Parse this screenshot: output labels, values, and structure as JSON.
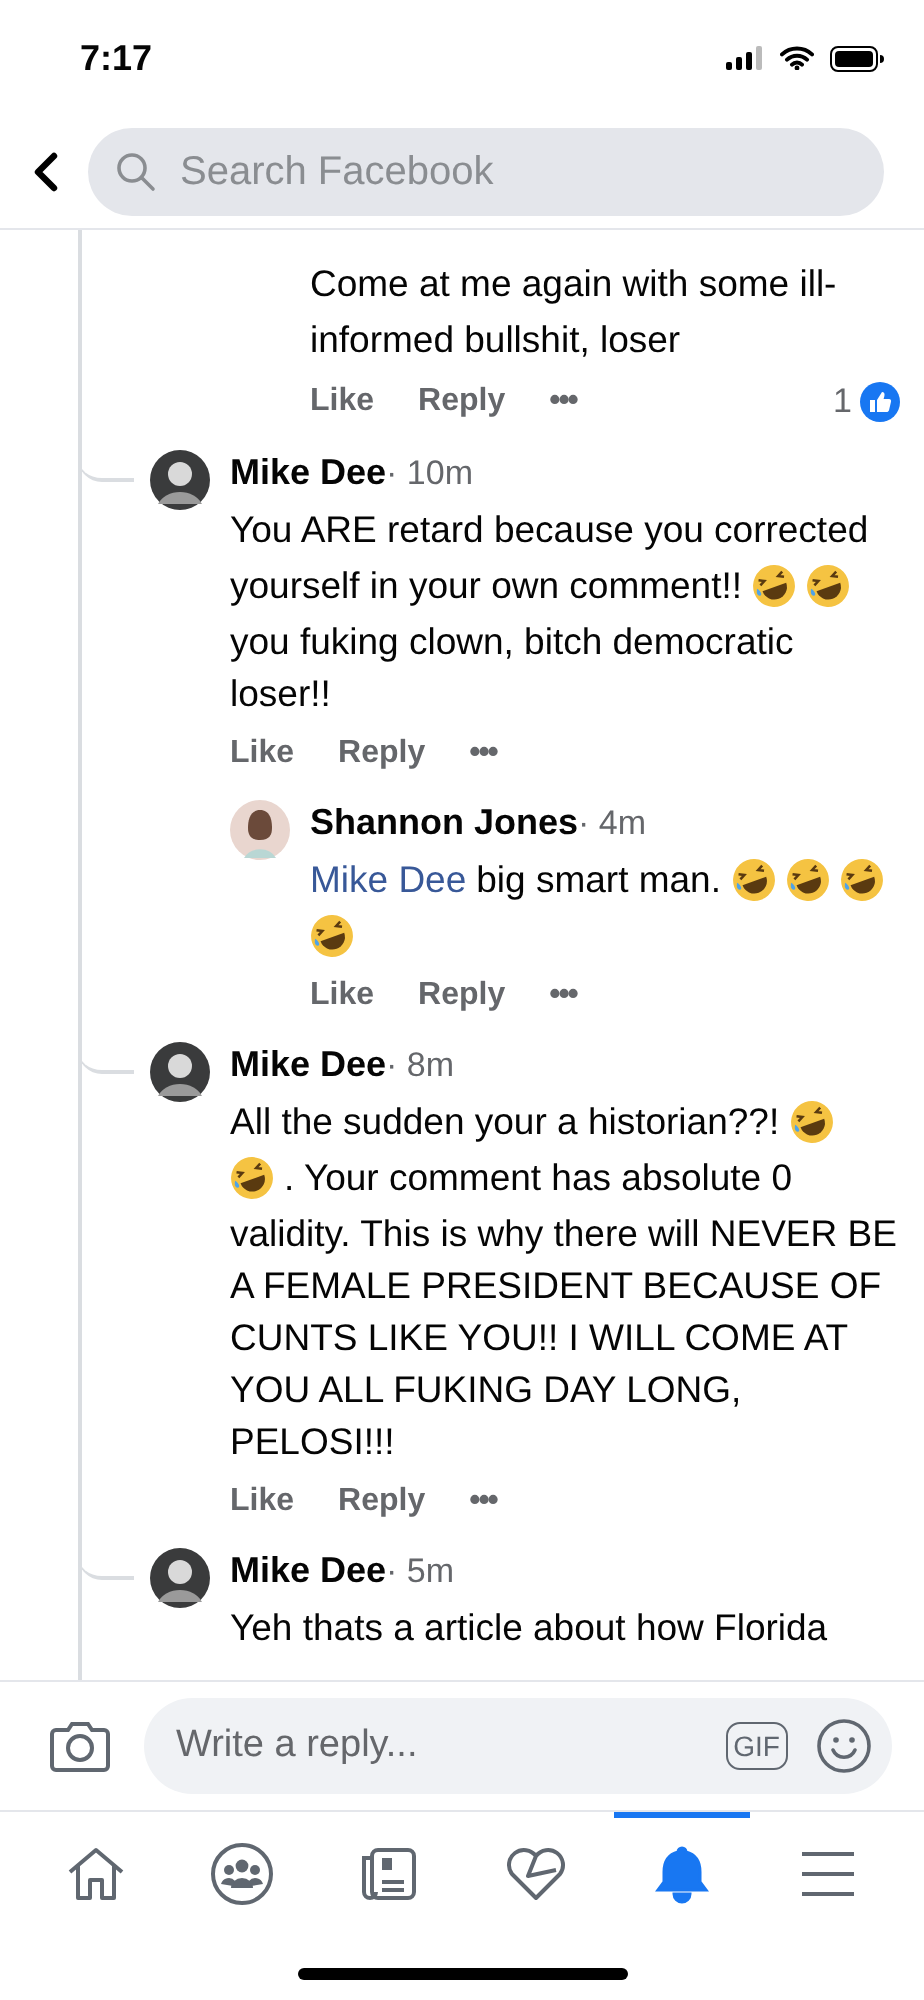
{
  "status_bar": {
    "time": "7:17"
  },
  "search": {
    "placeholder": "Search Facebook"
  },
  "comments": [
    {
      "replies": [
        {
          "lines": [
            [
              {
                "kind": "text",
                "text": "Come at me again with some ill-"
              }
            ],
            [
              {
                "kind": "text",
                "text": "informed bullshit, loser"
              }
            ]
          ],
          "actions": [
            "Like",
            "Reply",
            "•••"
          ],
          "reaction_count": "1"
        }
      ]
    },
    {
      "author": "Mike Dee",
      "time": "· 10m",
      "lines": [
        [
          {
            "kind": "text",
            "text": "You ARE retard because you corrected"
          }
        ],
        [
          {
            "kind": "text",
            "text": "yourself in your own comment!!"
          },
          {
            "kind": "emoji"
          },
          {
            "kind": "emoji"
          }
        ],
        [
          {
            "kind": "text",
            "text": "you fuking clown, bitch democratic loser!!"
          }
        ]
      ],
      "actions": [
        "Like",
        "Reply",
        "•••"
      ],
      "replies": [
        {
          "author": "Shannon Jones",
          "time": "· 4m",
          "lines": [
            [
              {
                "kind": "mention",
                "text": "Mike Dee"
              },
              {
                "kind": "text",
                "text": "big smart man."
              },
              {
                "kind": "emoji"
              },
              {
                "kind": "emoji"
              },
              {
                "kind": "emoji"
              }
            ],
            [
              {
                "kind": "emoji"
              }
            ]
          ],
          "actions": [
            "Like",
            "Reply",
            "•••"
          ]
        }
      ]
    },
    {
      "author": "Mike Dee",
      "time": "· 8m",
      "lines": [
        [
          {
            "kind": "text",
            "text": "All the sudden your a historian??!"
          },
          {
            "kind": "emoji"
          }
        ],
        [
          {
            "kind": "emoji"
          },
          {
            "kind": "text",
            "text": ". Your comment has absolute 0"
          }
        ],
        [
          {
            "kind": "text",
            "text": "validity. This is why there will NEVER BE A FEMALE PRESIDENT BECAUSE OF CUNTS LIKE YOU!! I WILL COME AT YOU ALL FUKING DAY LONG, PELOSI!!!"
          }
        ]
      ],
      "actions": [
        "Like",
        "Reply",
        "•••"
      ]
    },
    {
      "author": "Mike Dee",
      "time": "· 5m",
      "lines": [
        [
          {
            "kind": "text",
            "text": "Yeh thats a article about how Florida"
          }
        ]
      ]
    }
  ],
  "composer": {
    "placeholder": "Write a reply...",
    "gif": "GIF"
  },
  "tabs": [
    {
      "kind": "home",
      "selected": false
    },
    {
      "kind": "groups",
      "selected": false
    },
    {
      "kind": "news",
      "selected": false
    },
    {
      "kind": "dating",
      "selected": false
    },
    {
      "kind": "bell",
      "selected": true
    },
    {
      "kind": "menu",
      "selected": false
    }
  ]
}
